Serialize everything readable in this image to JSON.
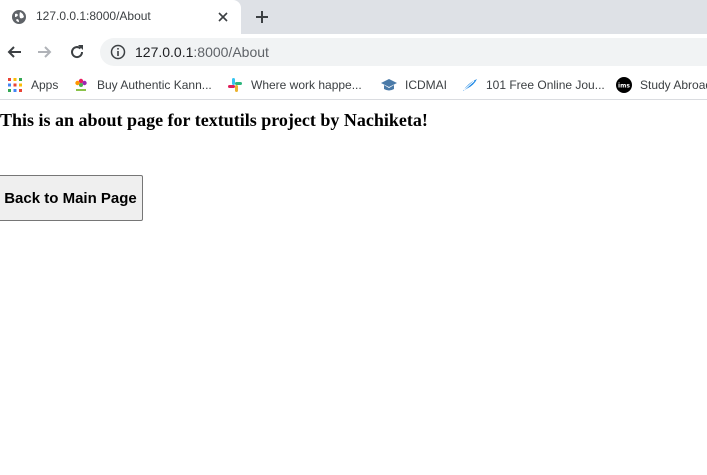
{
  "tab": {
    "title": "127.0.0.1:8000/About",
    "favicon": "globe-icon"
  },
  "toolbar": {
    "url_host": "127.0.0.1",
    "url_path": ":8000/About"
  },
  "bookmarks": [
    {
      "label": "Apps",
      "icon": "apps-grid-icon"
    },
    {
      "label": "Buy Authentic Kann...",
      "icon": "flower-logo-icon"
    },
    {
      "label": "Where work happe...",
      "icon": "slack-icon"
    },
    {
      "label": "ICDMAI",
      "icon": "graduation-cap-icon"
    },
    {
      "label": "101 Free Online Jou...",
      "icon": "feather-icon"
    },
    {
      "label": "Study Abroad",
      "icon": "ims-logo-icon"
    }
  ],
  "page": {
    "heading": "This is an about page for textutils project by Nachiketa!",
    "back_button": "Back to Main Page"
  },
  "colors": {
    "tabstrip": "#dee1e6",
    "omnibox": "#f1f3f4",
    "button_bg": "#efefef"
  }
}
